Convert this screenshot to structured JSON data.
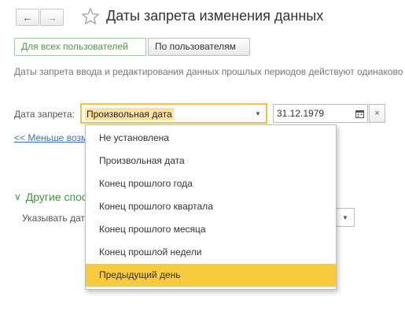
{
  "window": {
    "title": "Даты запрета изменения данных"
  },
  "tabs": [
    {
      "label": "Для всех пользователей",
      "active": true
    },
    {
      "label": "По пользователям",
      "active": false
    }
  ],
  "info_text": "Даты запрета ввода и редактирования данных прошлых периодов действуют одинаково для всех пользователей",
  "form": {
    "date_label": "Дата запрета:",
    "date_type_value": "Произвольная дата",
    "date_value": "31.12.1979",
    "less_link": "<< Меньше возможностей",
    "section_title": "Другие способы",
    "sub_label": "Указывать дату"
  },
  "dropdown": {
    "items": [
      "Не установлена",
      "Произвольная дата",
      "Конец прошлого года",
      "Конец прошлого квартала",
      "Конец прошлого месяца",
      "Конец прошлой недели",
      "Предыдущий день"
    ],
    "highlighted_index": 6
  },
  "colors": {
    "accent_yellow": "#f8cb3c",
    "selected_field_bg": "#fde2a4",
    "link_blue": "#3b6fc4",
    "green": "#3f9a3f"
  },
  "icons": {
    "back": "arrow-left-icon",
    "forward": "arrow-right-icon",
    "favorite": "star-icon",
    "dropdown": "chevron-down-icon",
    "calendar": "calendar-icon",
    "clear": "close-icon"
  }
}
